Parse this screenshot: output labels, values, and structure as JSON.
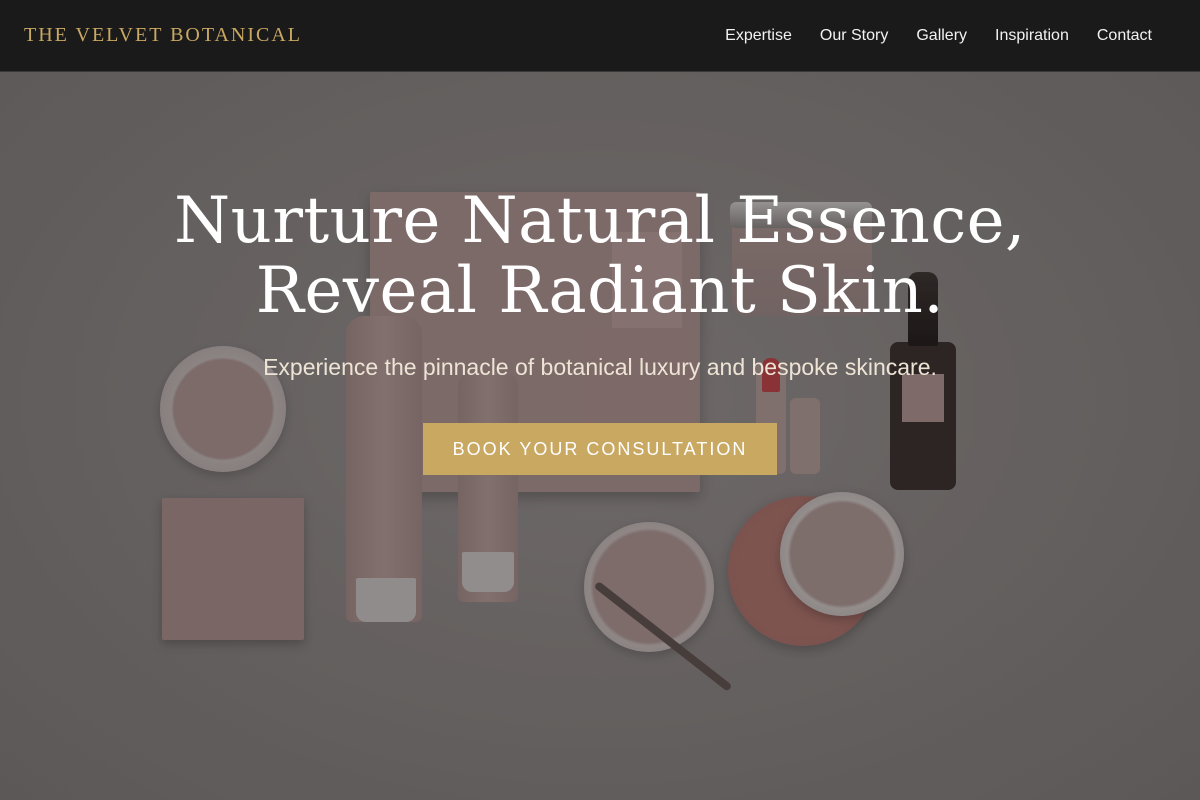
{
  "header": {
    "brand": "THE VELVET BOTANICAL",
    "nav": [
      {
        "label": "Expertise"
      },
      {
        "label": "Our Story"
      },
      {
        "label": "Gallery"
      },
      {
        "label": "Inspiration"
      },
      {
        "label": "Contact"
      }
    ]
  },
  "hero": {
    "title_line1": "Nurture Natural Essence,",
    "title_line2": "Reveal Radiant Skin.",
    "subtitle": "Experience the pinnacle of botanical luxury and bespoke skincare.",
    "cta_label": "BOOK YOUR CONSULTATION"
  },
  "colors": {
    "accent_gold": "#c9a862",
    "header_bg": "#1a1a1a",
    "hero_text": "#ffffff",
    "subtitle_text": "#ede4d6"
  }
}
